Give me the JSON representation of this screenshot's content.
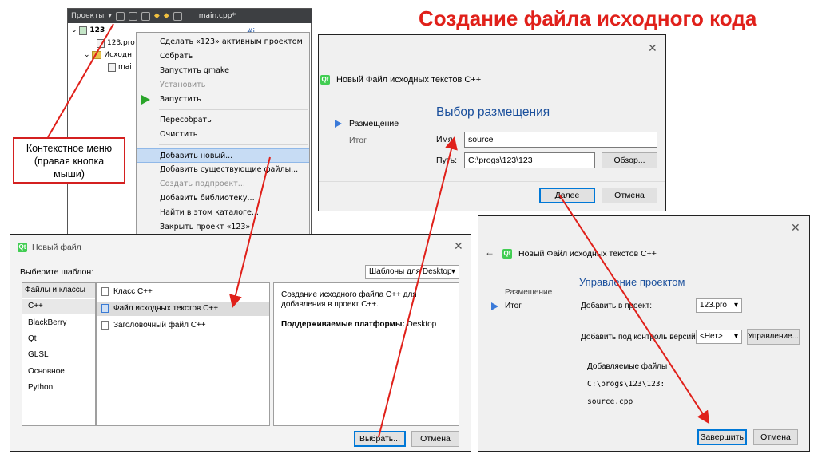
{
  "title": "Создание файла исходного кода",
  "ide": {
    "tab_projects": "Проекты",
    "tab_file": "main.cpp*",
    "tree": [
      "123",
      "123.pro",
      "Исходн",
      "mai"
    ],
    "code_snippet": "#i"
  },
  "context_menu": {
    "items": [
      "Сделать «123» активным проектом",
      "Собрать",
      "Запустить qmake",
      "Установить",
      "Запустить",
      "Пересобрать",
      "Очистить",
      "Добавить новый...",
      "Добавить существующие файлы...",
      "Создать подпроект...",
      "Добавить библиотеку...",
      "Найти в этом каталоге...",
      "Закрыть проект «123»"
    ],
    "selected": "Добавить новый...",
    "disabled": [
      "Установить",
      "Создать подпроект..."
    ]
  },
  "callout": {
    "line1": "Контекстное меню",
    "line2": "(правая кнопка",
    "line3": "мыши)"
  },
  "new_file_dialog": {
    "title": "Новый файл",
    "choose_label": "Выберите шаблон:",
    "filter": "Шаблоны для Desktop",
    "categories_header": "Файлы и классы",
    "categories": [
      "C++",
      "BlackBerry",
      "Qt",
      "GLSL",
      "Основное",
      "Python"
    ],
    "templates": [
      "Класс C++",
      "Файл исходных текстов C++",
      "Заголовочный файл C++"
    ],
    "description": "Создание исходного файла C++ для добавления в проект C++.",
    "platforms_label": "Поддерживаемые платформы:",
    "platforms_value": "Desktop",
    "btn_choose": "Выбрать...",
    "btn_cancel": "Отмена"
  },
  "location_dialog": {
    "title": "Новый Файл исходных текстов C++",
    "heading": "Выбор размещения",
    "step_current": "Размещение",
    "step_next": "Итог",
    "name_label": "Имя:",
    "name_value": "source",
    "path_label": "Путь:",
    "path_value": "C:\\progs\\123\\123",
    "btn_browse": "Обзор...",
    "btn_next": "Далее",
    "btn_cancel": "Отмена"
  },
  "summary_dialog": {
    "title": "Новый Файл исходных текстов C++",
    "heading": "Управление проектом",
    "step_prev": "Размещение",
    "step_current": "Итог",
    "add_to_project_label": "Добавить в проект:",
    "add_to_project_value": "123.pro",
    "vcs_label": "Добавить под контроль версий:",
    "vcs_value": "<Нет>",
    "btn_manage": "Управление...",
    "files_label": "Добавляемые файлы",
    "files_path": "C:\\progs\\123\\123:",
    "files_name": "source.cpp",
    "btn_finish": "Завершить",
    "btn_cancel": "Отмена"
  },
  "colors": {
    "accent_red": "#e0201a",
    "qt_green": "#41cd52",
    "step_arrow": "#3b7ad9",
    "selection": "#c7dcf4"
  }
}
